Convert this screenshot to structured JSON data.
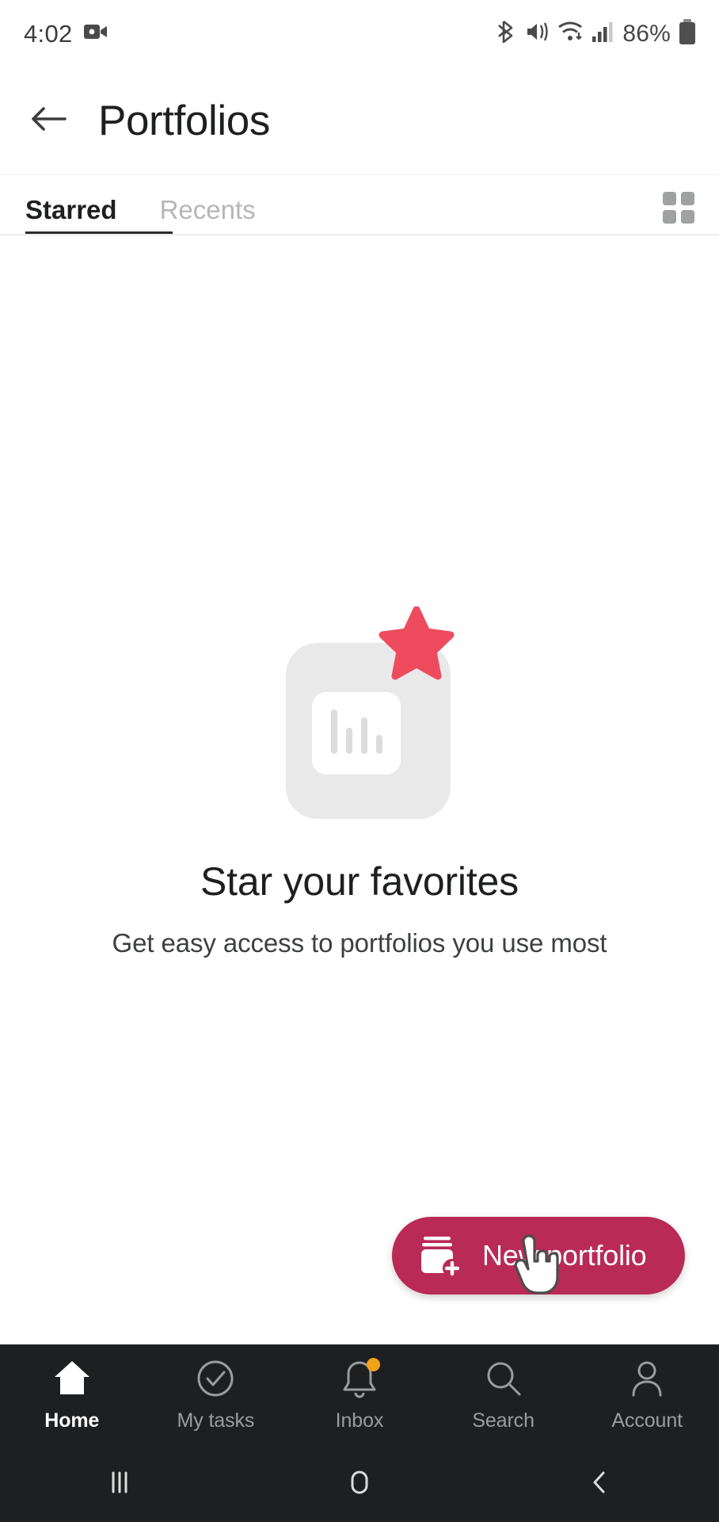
{
  "status_bar": {
    "time": "4:02",
    "battery_percent": "86%",
    "icons": [
      "screen-record-icon",
      "bluetooth-icon",
      "mute-vibrate-icon",
      "wifi-icon",
      "cellular-signal-icon",
      "battery-icon"
    ]
  },
  "header": {
    "title": "Portfolios",
    "back_icon": "back-arrow-icon"
  },
  "tabs": {
    "items": [
      {
        "label": "Starred",
        "active": true
      },
      {
        "label": "Recents",
        "active": false
      }
    ],
    "view_toggle_icon": "grid-view-icon"
  },
  "empty_state": {
    "illustration": "starred-portfolio-illustration",
    "title": "Star your favorites",
    "subtitle": "Get easy access to portfolios you use most",
    "star_color": "#ef4b5e",
    "card_color": "#e9e9ea"
  },
  "fab": {
    "label": "New portfolio",
    "icon": "new-portfolio-icon",
    "color": "#b92a56"
  },
  "cursor": {
    "icon": "pointer-hand-cursor"
  },
  "bottom_nav": {
    "background": "#1e1f21",
    "items": [
      {
        "label": "Home",
        "icon": "home-icon",
        "active": true,
        "badge": false
      },
      {
        "label": "My tasks",
        "icon": "check-circle-icon",
        "active": false,
        "badge": false
      },
      {
        "label": "Inbox",
        "icon": "bell-icon",
        "active": false,
        "badge": true
      },
      {
        "label": "Search",
        "icon": "search-icon",
        "active": false,
        "badge": false
      },
      {
        "label": "Account",
        "icon": "person-icon",
        "active": false,
        "badge": false
      }
    ]
  },
  "system_nav": {
    "items": [
      {
        "icon": "recents-icon"
      },
      {
        "icon": "home-circle-icon"
      },
      {
        "icon": "back-chevron-icon"
      }
    ]
  }
}
